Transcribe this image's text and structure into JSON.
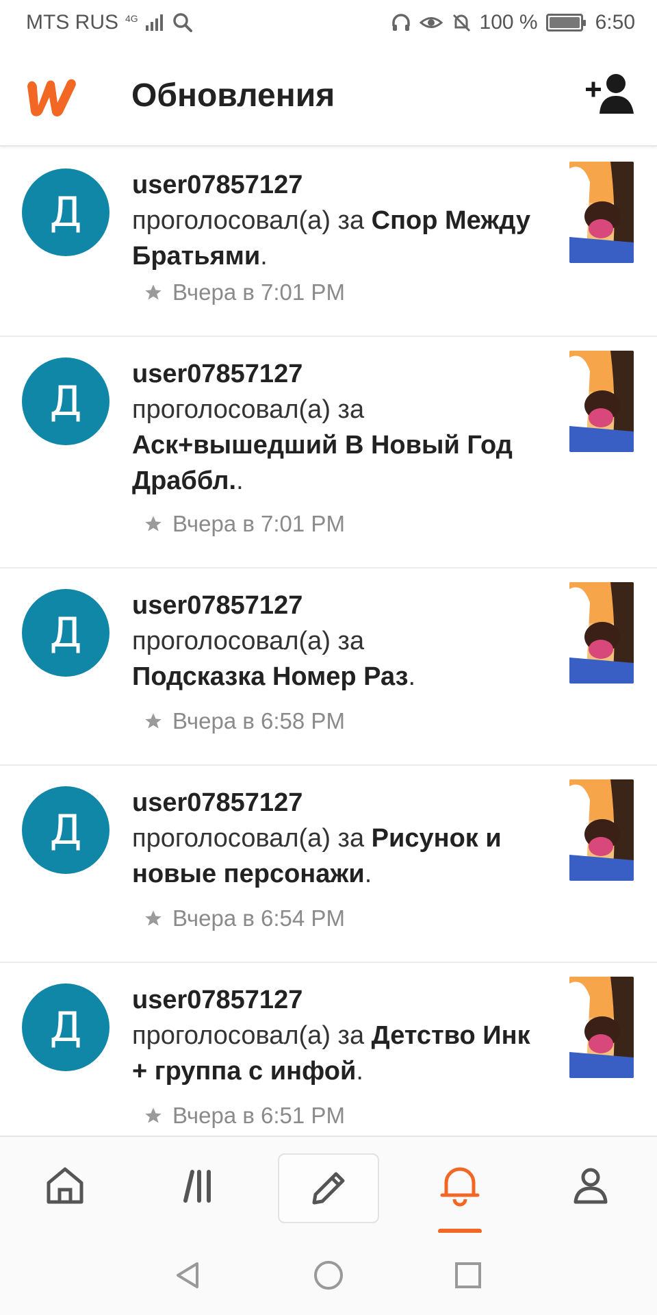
{
  "status_bar": {
    "carrier": "MTS RUS",
    "network": "4G",
    "battery": "100 %",
    "time": "6:50"
  },
  "header": {
    "title": "Обновления"
  },
  "feed": {
    "items": [
      {
        "avatar_letter": "Д",
        "user": "user07857127",
        "action": "проголосовал(а) за",
        "story": "Спор Между Братьями",
        "time": "Вчера в 7:01 PM"
      },
      {
        "avatar_letter": "Д",
        "user": "user07857127",
        "action": "проголосовал(а) за",
        "story": "Аск+вышедший В Новый Год Драббл.",
        "time": "Вчера в 7:01 PM"
      },
      {
        "avatar_letter": "Д",
        "user": "user07857127",
        "action": "проголосовал(а) за",
        "story": "Подсказка Номер Раз",
        "time": "Вчера в 6:58 PM"
      },
      {
        "avatar_letter": "Д",
        "user": "user07857127",
        "action": "проголосовал(а) за",
        "story": "Рисунок и новые персонажи",
        "time": "Вчера в 6:54 PM"
      },
      {
        "avatar_letter": "Д",
        "user": "user07857127",
        "action": "проголосовал(а) за",
        "story": "Детство Инк + группа с инфой",
        "time": "Вчера в 6:51 PM"
      }
    ]
  },
  "bottom_nav": {
    "items": [
      "home-icon",
      "library-icon",
      "write-icon",
      "notifications-icon",
      "profile-icon"
    ],
    "active": "notifications-icon"
  },
  "colors": {
    "brand": "#f26724",
    "avatar_bg": "#1187a8"
  }
}
